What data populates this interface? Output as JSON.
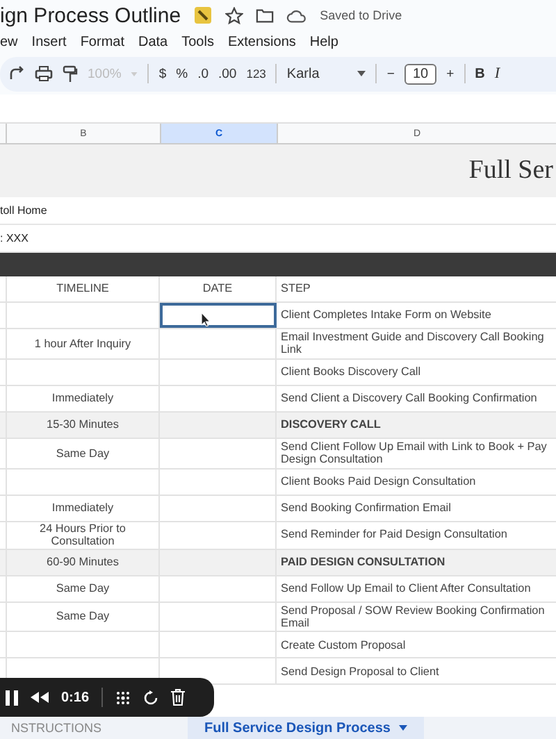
{
  "doc": {
    "title": "ign Process Outline",
    "status": "Saved to Drive"
  },
  "menu": [
    "ew",
    "Insert",
    "Format",
    "Data",
    "Tools",
    "Extensions",
    "Help"
  ],
  "toolbar": {
    "zoom": "100%",
    "currency": "$",
    "percent": "%",
    "dec_less": ".0",
    "dec_more": ".00",
    "format": "123",
    "font": "Karla",
    "minus": "−",
    "size": "10",
    "plus": "+",
    "bold": "B",
    "italic": "I"
  },
  "columns": [
    {
      "label": "B",
      "selected": false
    },
    {
      "label": "C",
      "selected": true
    },
    {
      "label": "D",
      "selected": false
    }
  ],
  "sheet": {
    "banner": "Full Ser",
    "lines": [
      "toll Home",
      ": XXX"
    ],
    "headers": [
      "TIMELINE",
      "DATE",
      "STEP"
    ],
    "rows": [
      {
        "kind": "step",
        "timeline": "",
        "step": "Client Completes Intake Form on Website",
        "selected": true
      },
      {
        "kind": "step",
        "timeline": "1 hour After Inquiry",
        "step": "Email Investment Guide and Discovery Call Booking Link",
        "selected": false
      },
      {
        "kind": "step",
        "timeline": "",
        "step": "Client Books Discovery Call",
        "selected": false
      },
      {
        "kind": "step",
        "timeline": "Immediately",
        "step": "Send Client a Discovery Call Booking Confirmation",
        "selected": false
      },
      {
        "kind": "phase",
        "timeline": "15-30 Minutes",
        "step": "DISCOVERY CALL",
        "selected": false
      },
      {
        "kind": "step",
        "timeline": "Same Day",
        "step": "Send Client Follow Up Email with Link to Book + Pay Design Consultation",
        "selected": false
      },
      {
        "kind": "step",
        "timeline": "",
        "step": "Client Books Paid Design Consultation",
        "selected": false
      },
      {
        "kind": "step",
        "timeline": "Immediately",
        "step": "Send Booking Confirmation Email",
        "selected": false
      },
      {
        "kind": "step",
        "timeline": "24 Hours Prior to Consultation",
        "step": "Send Reminder for Paid Design Consultation",
        "selected": false
      },
      {
        "kind": "phase",
        "timeline": "60-90 Minutes",
        "step": "PAID DESIGN CONSULTATION",
        "selected": false
      },
      {
        "kind": "step",
        "timeline": "Same Day",
        "step": "Send Follow Up Email to Client After Consultation",
        "selected": false
      },
      {
        "kind": "step",
        "timeline": "Same Day",
        "step": "Send Proposal / SOW Review Booking Confirmation Email",
        "selected": false
      },
      {
        "kind": "step",
        "timeline": "",
        "step": "Create Custom Proposal",
        "selected": false
      },
      {
        "kind": "step",
        "timeline": "",
        "step": "Send Design Proposal to Client",
        "selected": false
      }
    ]
  },
  "player": {
    "time": "0:16"
  },
  "tabs": [
    {
      "label": "NSTRUCTIONS",
      "selected": false
    },
    {
      "label": "Full Service Design Process",
      "selected": true
    }
  ]
}
